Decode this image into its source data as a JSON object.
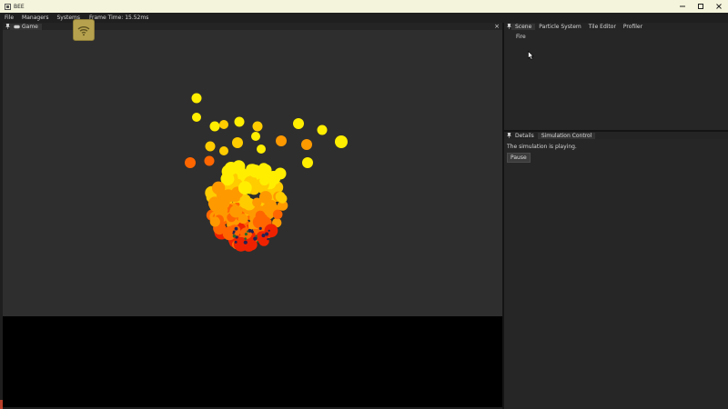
{
  "window": {
    "title": "BEE",
    "controls": [
      "minimize-icon",
      "maximize-icon",
      "close-icon"
    ]
  },
  "menu": {
    "items": [
      "File",
      "Managers",
      "Systems"
    ],
    "frame_time": "Frame Time: 15.52ms"
  },
  "game_panel": {
    "tab_label": "Game",
    "close_glyph": "×",
    "viewport_bg": "#2e2e2e",
    "particle_colors": [
      "#ffee00",
      "#ffcc00",
      "#ff9900",
      "#ff6600",
      "#ee2200"
    ]
  },
  "scene_panel": {
    "tabs": [
      "Scene",
      "Particle System",
      "Tile Editor",
      "Profiler"
    ],
    "tree_items": [
      "Fire"
    ]
  },
  "details_panel": {
    "tabs": [
      "Details",
      "Simulation Control"
    ],
    "status_text": "The simulation is playing.",
    "pause_label": "Pause"
  }
}
